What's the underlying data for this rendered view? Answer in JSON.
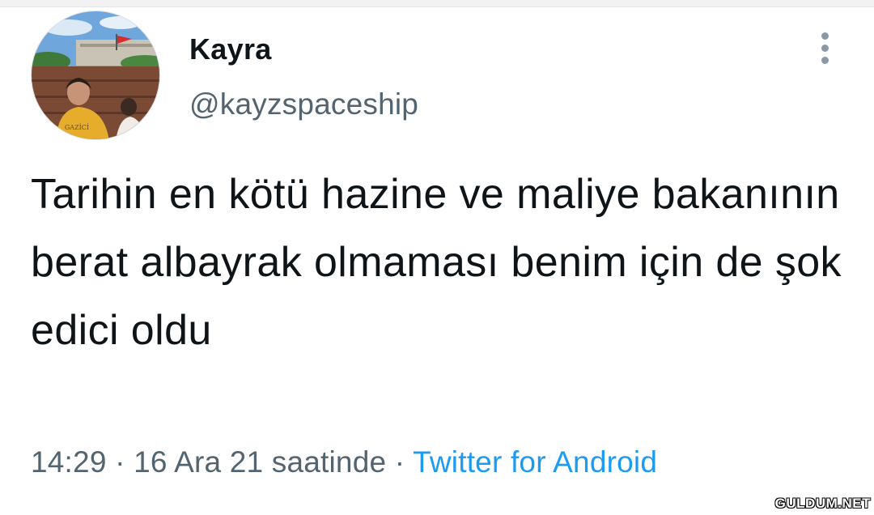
{
  "tweet": {
    "author": {
      "display_name": "Kayra",
      "handle": "@kayzspaceship",
      "avatar_shirt_text": "GAZİCİ"
    },
    "text": "Tarihin en kötü hazine ve maliye bakanının berat albayrak olmaması benim için de şok edici oldu",
    "time": "14:29",
    "separator": "·",
    "date": "16 Ara 21 saatinde",
    "source": "Twitter for Android",
    "more_icon": "vertical-ellipsis-icon"
  },
  "watermark": "GULDUM.NET",
  "colors": {
    "text_primary": "#0f1419",
    "text_secondary": "#536471",
    "link": "#1d9bf0"
  }
}
